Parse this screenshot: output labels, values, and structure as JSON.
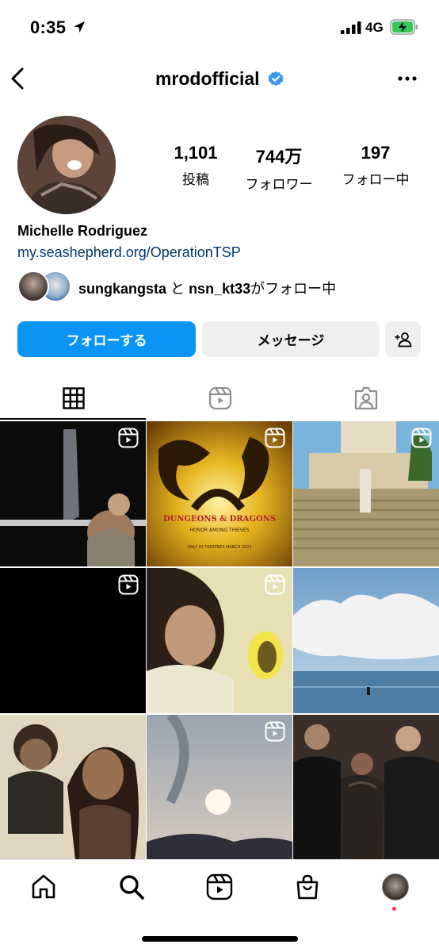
{
  "status_bar": {
    "time": "0:35",
    "network": "4G"
  },
  "header": {
    "username": "mrodofficial"
  },
  "profile": {
    "name": "Michelle Rodriguez",
    "link": "my.seashepherd.org/OperationTSP",
    "stats": [
      {
        "value": "1,101",
        "label": "投稿"
      },
      {
        "value": "744万",
        "label": "フォロワー"
      },
      {
        "value": "197",
        "label": "フォロー中"
      }
    ],
    "followed_by": {
      "user1": "sungkangsta",
      "connector": "と",
      "user2": "nsn_kt33",
      "suffix": "がフォロー中"
    }
  },
  "buttons": {
    "follow": "フォローする",
    "message": "メッセージ"
  },
  "posts": [
    {
      "reel": true,
      "title": ""
    },
    {
      "reel": true,
      "title": "DUNGEONS & DRAGONS",
      "subtitle": "HONOR AMONG THIEVES",
      "note": "ONLY IN THEATRES MARCH 2023"
    },
    {
      "reel": true,
      "title": ""
    },
    {
      "reel": true,
      "title": ""
    },
    {
      "reel": true,
      "title": ""
    },
    {
      "reel": false,
      "title": ""
    },
    {
      "reel": false,
      "title": ""
    },
    {
      "reel": true,
      "title": ""
    },
    {
      "reel": false,
      "title": ""
    }
  ],
  "colors": {
    "accent": "#0a95f6",
    "link": "#00376b",
    "verified": "#3897f0",
    "notification": "#ff3040"
  }
}
